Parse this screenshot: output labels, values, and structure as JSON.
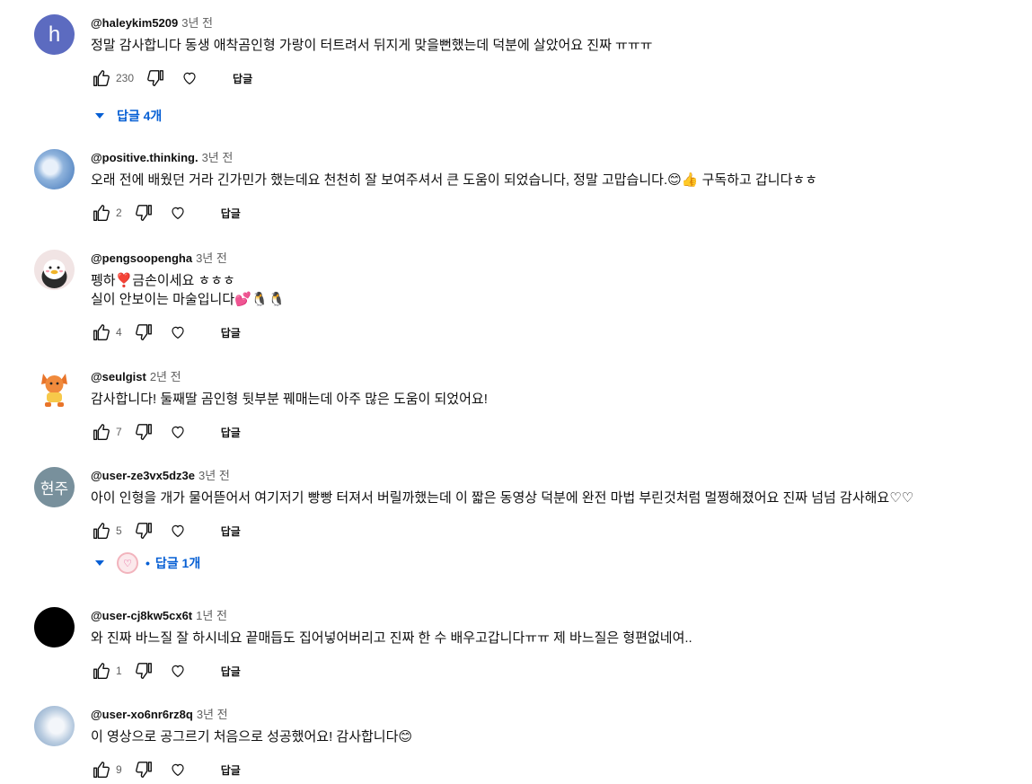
{
  "comments": [
    {
      "author": "@haleykim5209",
      "time": "3년 전",
      "avatar_letter": "h",
      "text": "정말 감사합니다 동생 애착곰인형 가랑이 터트려서 뒤지게 맞을뻔했는데 덕분에 살았어요 진짜 ㅠㅠㅠ",
      "likes": "230",
      "reply_label": "답글",
      "replies": "답글 4개"
    },
    {
      "author": "@positive.thinking.",
      "time": "3년 전",
      "text": "오래 전에 배웠던 거라 긴가민가 했는데요 천천히 잘 보여주셔서 큰 도움이 되었습니다, 정말 고맙습니다.😊👍 구독하고 갑니다ㅎㅎ",
      "likes": "2",
      "reply_label": "답글"
    },
    {
      "author": "@pengsoopengha",
      "time": "3년 전",
      "text": "펭하❣️금손이세요 ㅎㅎㅎ\n실이 안보이는 마술입니다💕🐧🐧",
      "likes": "4",
      "reply_label": "답글"
    },
    {
      "author": "@seulgist",
      "time": "2년 전",
      "text": "감사합니다! 둘째딸 곰인형 뒷부분 꿰매는데 아주 많은 도움이 되었어요!",
      "likes": "7",
      "reply_label": "답글"
    },
    {
      "author": "@user-ze3vx5dz3e",
      "time": "3년 전",
      "avatar_text": "현주",
      "text": "아이 인형을 개가 물어뜯어서 여기저기 빵빵 터져서 버릴까했는데 이 짧은 동영상 덕분에 완전 마법 부린것처럼 멀쩡해졌어요 진짜 넘넘 감사해요♡♡",
      "likes": "5",
      "reply_label": "답글",
      "replies": "답글 1개"
    },
    {
      "author": "@user-cj8kw5cx6t",
      "time": "1년 전",
      "text": "와 진짜 바느질 잘 하시네요 끝매듭도 집어넣어버리고 진짜 한 수 배우고갑니다ㅠㅠ 제 바느질은 형편없네여..",
      "likes": "1",
      "reply_label": "답글"
    },
    {
      "author": "@user-xo6nr6rz8q",
      "time": "3년 전",
      "text": "이 영상으로 공그르기 처음으로 성공했어요! 감사합니다😊",
      "likes": "9",
      "reply_label": "답글"
    }
  ],
  "colors": {
    "link": "#065fd4",
    "muted": "#606060"
  }
}
